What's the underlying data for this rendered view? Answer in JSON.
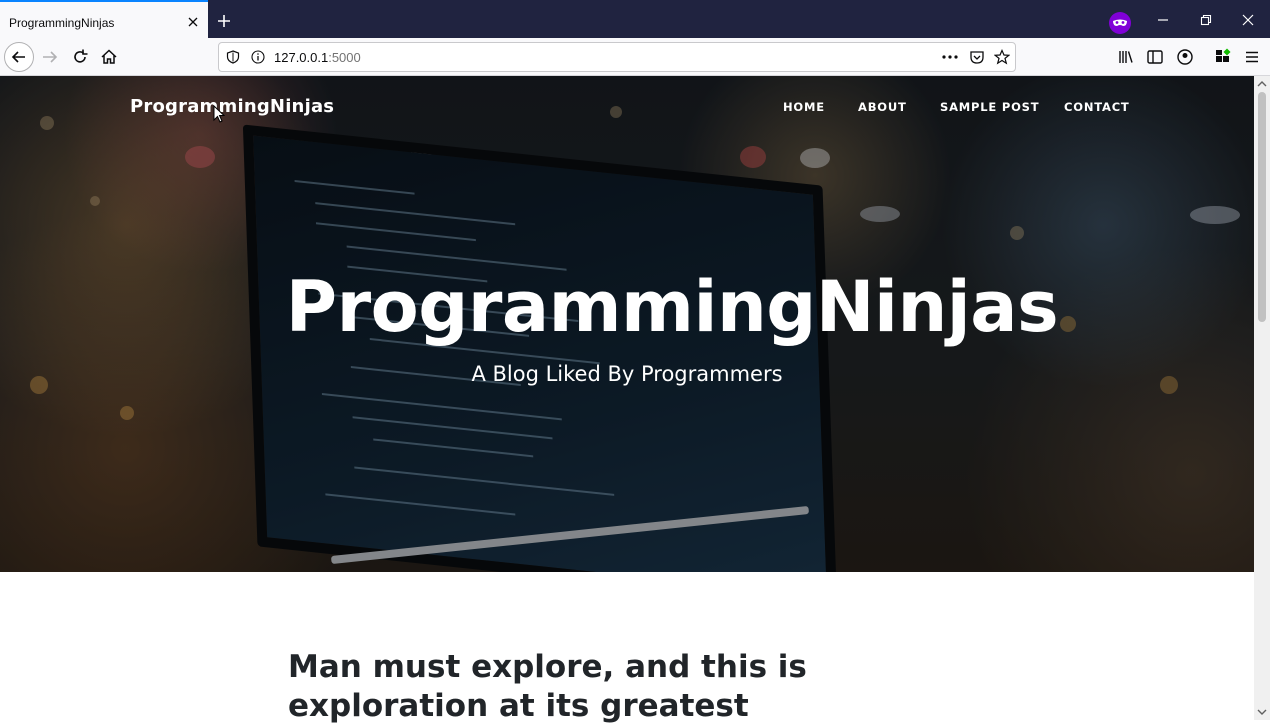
{
  "browser": {
    "tab_title": "ProgrammingNinjas",
    "url_host": "127.0.0.1",
    "url_port": ":5000",
    "icons": [
      "close-icon",
      "plus-icon",
      "private-mask-icon",
      "minimize-icon",
      "restore-icon",
      "window-close-icon",
      "back-arrow-icon",
      "forward-arrow-icon",
      "reload-icon",
      "home-icon",
      "shield-icon",
      "info-icon",
      "more-icon",
      "pocket-icon",
      "star-icon",
      "library-icon",
      "sidebar-icon",
      "account-icon",
      "extensions-icon",
      "hamburger-menu-icon"
    ]
  },
  "site": {
    "brand": "ProgrammingNinjas",
    "nav": {
      "home": "HOME",
      "about": "ABOUT",
      "sample_post": "SAMPLE POST",
      "contact": "CONTACT"
    },
    "hero_title": "ProgrammingNinjas",
    "hero_subtitle": "A Blog Liked By Programmers",
    "post_title": "Man must explore, and this is exploration at its greatest"
  },
  "colors": {
    "tabbar": "#202340",
    "accent": "#0a84ff",
    "private": "#8000d7",
    "text_dark": "#212529"
  }
}
